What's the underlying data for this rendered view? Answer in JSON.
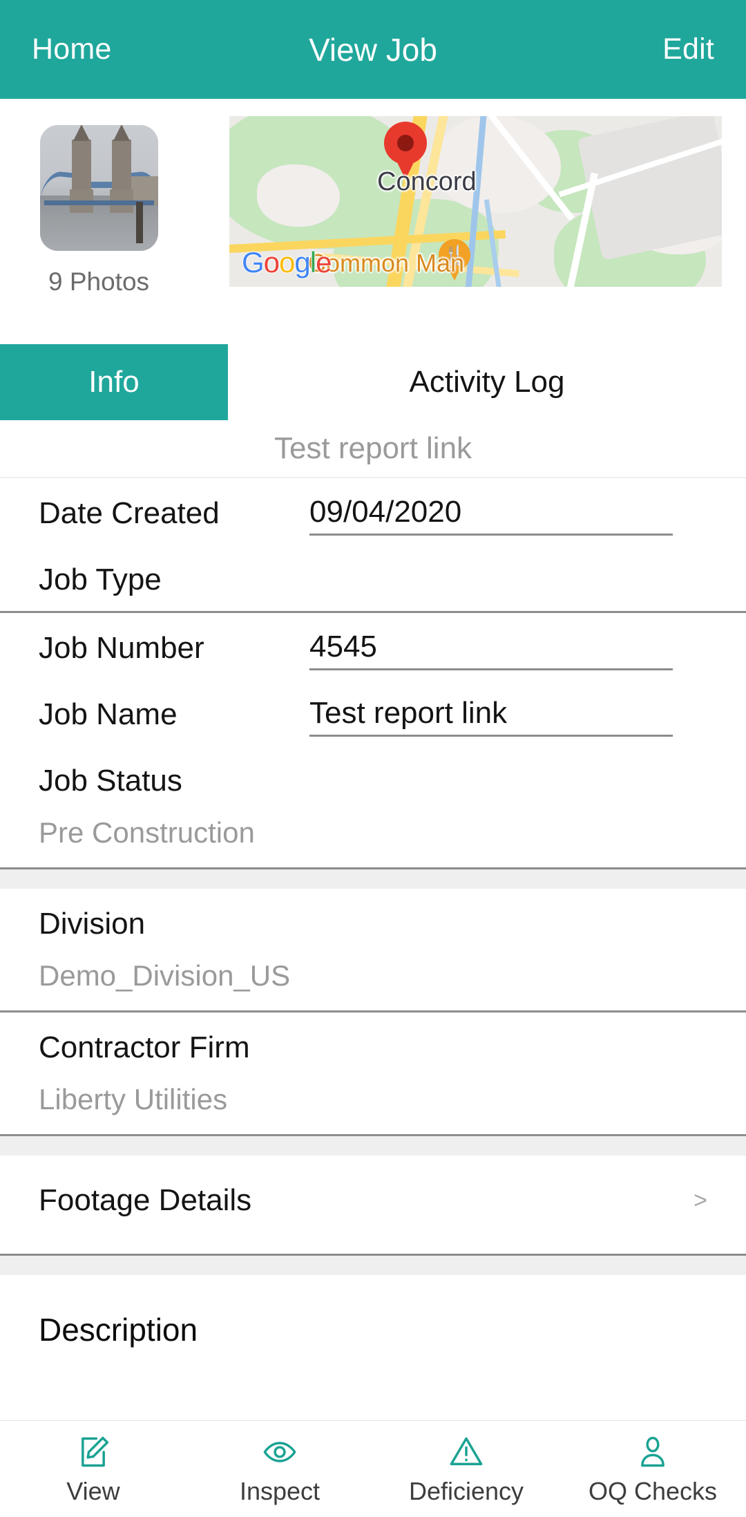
{
  "header": {
    "back_label": "Home",
    "title": "View Job",
    "action_label": "Edit"
  },
  "media": {
    "photos_count_label": "9 Photos",
    "thumbnail_alt": "job-photo-thumbnail",
    "map": {
      "city_label": "Concord",
      "poi_label": "Common Man",
      "google_logo": {
        "g1": "G",
        "o1": "o",
        "o2": "o",
        "g2": "g",
        "l": "l",
        "e": "e"
      },
      "marker_icon": "map-pin-icon",
      "poi_icon": "restaurant-icon"
    }
  },
  "tabs": [
    {
      "label": "Info",
      "active": true
    },
    {
      "label": "Activity Log",
      "active": false
    }
  ],
  "form": {
    "title": "Test report link",
    "groups": [
      {
        "fields": [
          {
            "label": "Date Created",
            "value": "09/04/2020",
            "underline": true
          },
          {
            "label": "Job Type",
            "value": "",
            "underline": false
          }
        ]
      },
      {
        "fields": [
          {
            "label": "Job Number",
            "value": "4545",
            "underline": true
          },
          {
            "label": "Job Name",
            "value": "Test report link",
            "underline": true
          }
        ],
        "stacked": [
          {
            "label": "Job Status",
            "value": "Pre Construction"
          }
        ]
      },
      {
        "stacked": [
          {
            "label": "Division",
            "value": "Demo_Division_US"
          }
        ]
      },
      {
        "stacked": [
          {
            "label": "Contractor Firm",
            "value": "Liberty Utilities"
          }
        ]
      },
      {
        "nav": {
          "label": "Footage Details",
          "chevron": ">"
        }
      }
    ],
    "description_label": "Description"
  },
  "bottom_nav": [
    {
      "label": "View",
      "icon": "edit-document-icon"
    },
    {
      "label": "Inspect",
      "icon": "eye-icon"
    },
    {
      "label": "Deficiency",
      "icon": "warning-triangle-icon"
    },
    {
      "label": "OQ Checks",
      "icon": "person-icon"
    }
  ],
  "colors": {
    "accent_teal": "#20a79c",
    "map_pin_red": "#e8392d",
    "poi_orange": "#f2a124",
    "muted_text": "#9a9a9a"
  }
}
